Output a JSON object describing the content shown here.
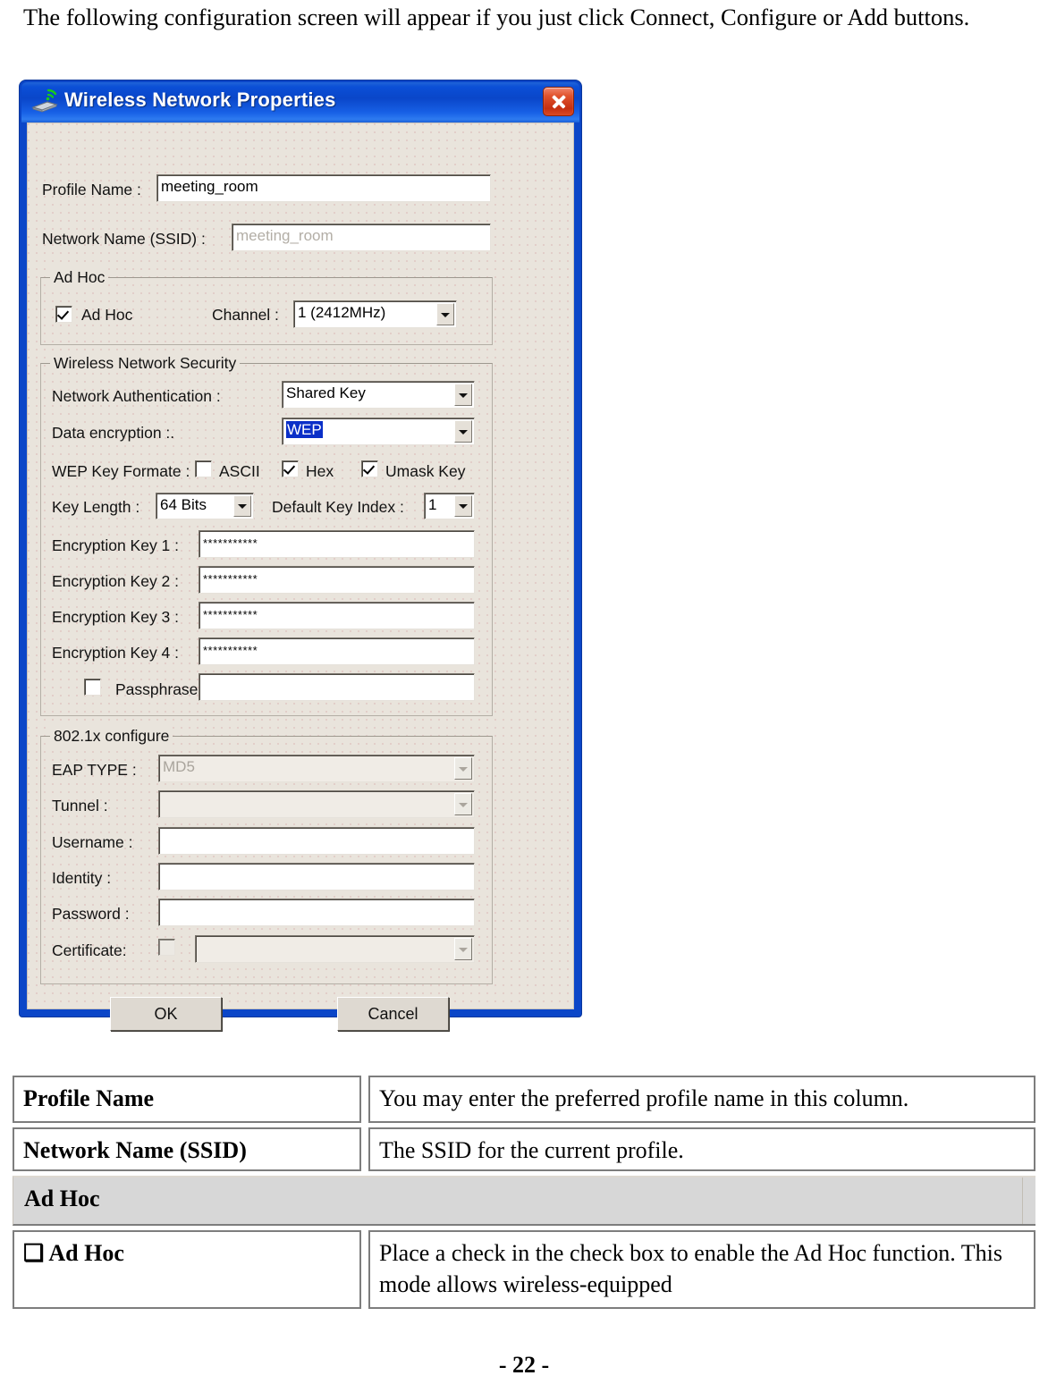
{
  "document": {
    "intro_paragraph": "The following configuration screen will appear if you just click Connect, Configure or Add buttons.",
    "page_number": "- 22 -"
  },
  "dialog": {
    "title": "Wireless Network Properties",
    "title_icon": "wireless-adapter-icon",
    "close_icon": "close-icon",
    "fields": {
      "profile_name_label": "Profile Name :",
      "profile_name_value": "meeting_room",
      "ssid_label": "Network Name (SSID) :",
      "ssid_value": "meeting_room"
    },
    "adhoc_group": {
      "title": "Ad Hoc",
      "checkbox_label": "Ad Hoc",
      "checkbox_checked": true,
      "channel_label": "Channel :",
      "channel_value": "1  (2412MHz)"
    },
    "security_group": {
      "title": "Wireless Network Security",
      "auth_label": "Network Authentication :",
      "auth_value": "Shared Key",
      "encryption_label": "Data encryption :.",
      "encryption_value": "WEP",
      "encryption_value_selected": true,
      "wep_format_label": "WEP Key Formate :",
      "ascii_label": "ASCII",
      "ascii_checked": false,
      "hex_label": "Hex",
      "hex_checked": true,
      "umask_label": "Umask Key",
      "umask_checked": true,
      "key_length_label": "Key Length :",
      "key_length_value": "64 Bits",
      "default_key_index_label": "Default Key Index :",
      "default_key_index_value": "1",
      "key1_label": "Encryption Key 1 :",
      "key1_value": "***********",
      "key2_label": "Encryption Key 2 :",
      "key2_value": "***********",
      "key3_label": "Encryption Key 3 :",
      "key3_value": "***********",
      "key4_label": "Encryption Key 4 :",
      "key4_value": "***********",
      "passphrase_label": "Passphrase :",
      "passphrase_checked": false,
      "passphrase_value": ""
    },
    "dot1x_group": {
      "title": "802.1x configure",
      "eap_type_label": "EAP TYPE :",
      "eap_type_value": "MD5",
      "tunnel_label": "Tunnel :",
      "tunnel_value": "",
      "username_label": "Username :",
      "username_value": "",
      "identity_label": "Identity :",
      "identity_value": "",
      "password_label": "Password :",
      "password_value": "",
      "certificate_label": "Certificate:",
      "certificate_checked": false,
      "certificate_value": ""
    },
    "buttons": {
      "ok": "OK",
      "cancel": "Cancel"
    },
    "colors": {
      "titlebar_blue": "#0b46c8",
      "close_red": "#c62f10",
      "client_face": "#e9e4dc",
      "selection_blue": "#0a2fc8"
    }
  },
  "table": {
    "rows": [
      {
        "key": "Profile Name",
        "value": "You may enter the preferred profile name in this column."
      },
      {
        "key": "Network Name (SSID)",
        "value": "The SSID for the current profile."
      }
    ],
    "band_label": "Ad Hoc",
    "adhoc_row": {
      "key": "❑ Ad Hoc",
      "value": "Place a check in the check box to enable the Ad Hoc function. This mode allows wireless-equipped"
    }
  }
}
